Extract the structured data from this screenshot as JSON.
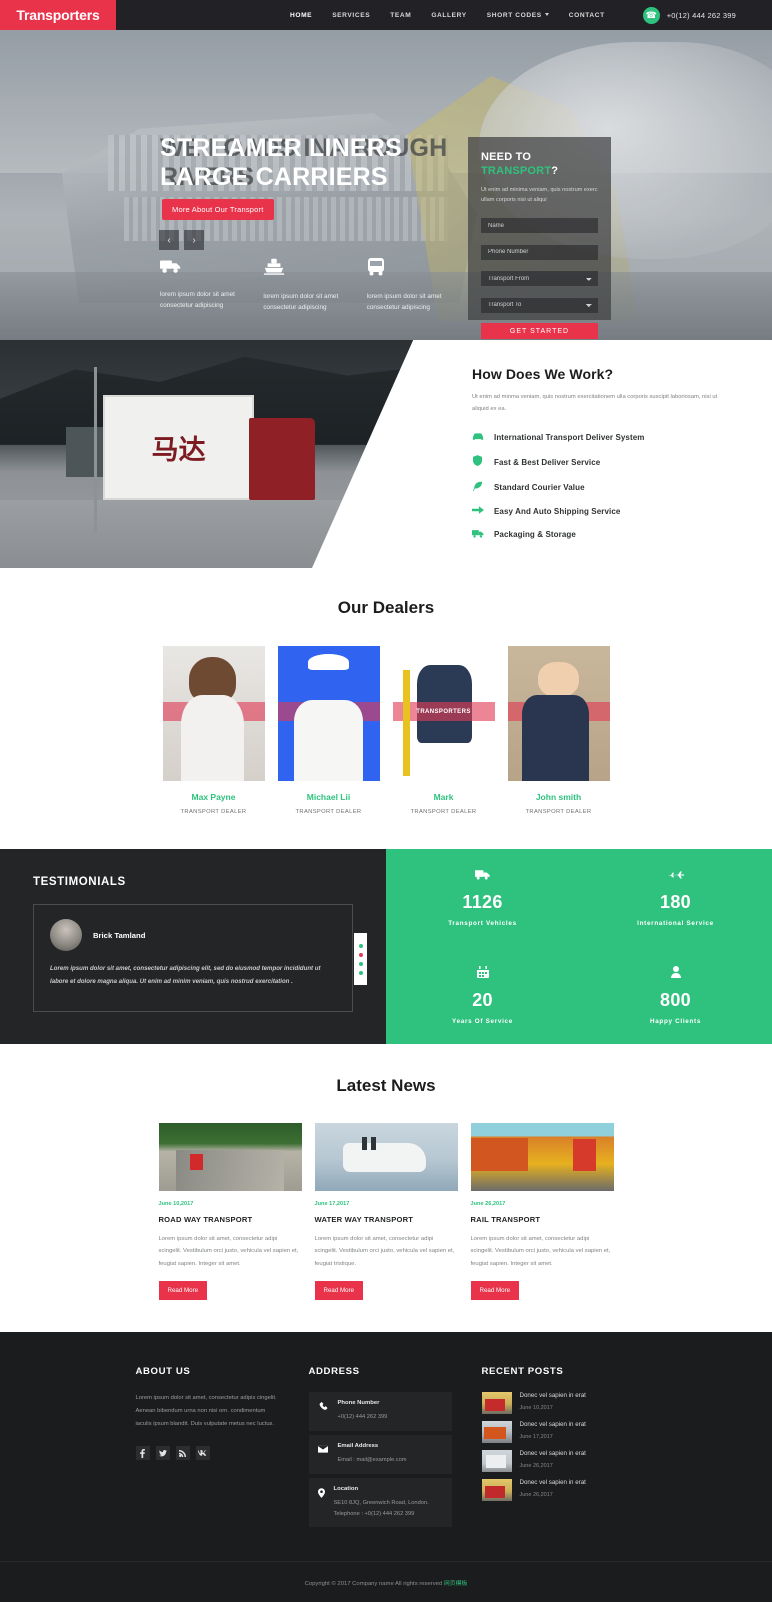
{
  "header": {
    "brand": "Transporters",
    "nav": [
      {
        "label": "HOME",
        "active": true
      },
      {
        "label": "SERVICES",
        "active": false
      },
      {
        "label": "TEAM",
        "active": false
      },
      {
        "label": "GALLERY",
        "active": false
      },
      {
        "label": "SHORT CODES",
        "active": false,
        "caret": true
      },
      {
        "label": "CONTACT",
        "active": false
      }
    ],
    "phone": "+0(12) 444 262 399",
    "phone_icon": "phone-icon"
  },
  "hero": {
    "title_line1": "STREAMER LINERS",
    "title_line2": "LARGE CARRIERS",
    "ghost_line1": "WE LOADS IN",
    "ghost_line2": "A ROUGH RIVERS",
    "button": "More About Our Transport",
    "prev_icon": "chevron-left-icon",
    "next_icon": "chevron-right-icon",
    "features": [
      {
        "icon": "truck-icon",
        "glyph": "🚚",
        "text": "lorem ipsum dolor sit amet consectetur adipiscing"
      },
      {
        "icon": "ship-icon",
        "glyph": "⚓",
        "text": "lorem ipsum dolor sit amet consectetur adipiscing"
      },
      {
        "icon": "bus-icon",
        "glyph": "🚌",
        "text": "lorem ipsum dolor sit amet consectetur adipiscing"
      }
    ],
    "form": {
      "title_a": "NEED TO",
      "title_b": "TRANSPORT",
      "title_c": "?",
      "desc": "Ut enim ad minima veniam, quis nostrum exerc ullam corporis nisi ut aliqui",
      "name_placeholder": "Name",
      "phone_placeholder": "Phone Number",
      "from_selected": "Transport From",
      "to_selected": "Transport To",
      "submit": "GET STARTED"
    }
  },
  "how": {
    "title": "How Does We Work?",
    "desc": "Ut enim ad minma veniam, quis nostrum exercitationem ulla corporis suscipit laboriosam, nisi ut aliquid ex ea.",
    "items": [
      {
        "icon": "car-icon",
        "glyph": "🚗",
        "label": "International Transport Deliver System"
      },
      {
        "icon": "shield-icon",
        "glyph": "🛡",
        "label": "Fast & Best Deliver Service"
      },
      {
        "icon": "feather-icon",
        "glyph": "✒",
        "label": "Standard Courier Value"
      },
      {
        "icon": "arrow-icon",
        "glyph": "➤",
        "label": "Easy And Auto Shipping Service"
      },
      {
        "icon": "truck-icon",
        "glyph": "🚚",
        "label": "Packaging & Storage"
      }
    ],
    "image_chars": "马达"
  },
  "dealers": {
    "title": "Our Dealers",
    "overlay_label": "TRANSPORTERS",
    "items": [
      {
        "name": "Max Payne",
        "role": "TRANSPORT DEALER"
      },
      {
        "name": "Michael Lii",
        "role": "TRANSPORT DEALER"
      },
      {
        "name": "Mark",
        "role": "TRANSPORT DEALER"
      },
      {
        "name": "John smith",
        "role": "TRANSPORT DEALER"
      }
    ]
  },
  "testimonials": {
    "heading": "TESTIMONIALS",
    "author": "Brick Tamland",
    "quote": "Lorem ipsum dolor sit amet, consectetur adipiscing elit, sed do eiusmod tempor incididunt ut labore et dolore magna aliqua. Ut enim ad minim veniam, quis nostrud exercitation .",
    "dots": [
      {
        "active": false
      },
      {
        "active": true
      },
      {
        "active": false
      },
      {
        "active": false
      }
    ]
  },
  "stats": [
    {
      "icon": "truck-icon",
      "glyph": "🚚",
      "number": "1126",
      "label": "Transport Vehicles"
    },
    {
      "icon": "plane-icon",
      "glyph": "✈",
      "number": "180",
      "label": "International Service"
    },
    {
      "icon": "calendar-icon",
      "glyph": "📅",
      "number": "20",
      "label": "Years Of Service"
    },
    {
      "icon": "user-icon",
      "glyph": "👤",
      "number": "800",
      "label": "Happy Clients"
    }
  ],
  "news": {
    "title": "Latest News",
    "items": [
      {
        "date": "June 10,2017",
        "title": "ROAD WAY TRANSPORT",
        "text": "Lorem ipsum dolor sit amet, consectetur adipi scingelit. Vestibulum orci justo, vehicula vel sapien et, feugiat sapien. Integer sit amet.",
        "button": "Read More"
      },
      {
        "date": "June 17,2017",
        "title": "WATER WAY TRANSPORT",
        "text": "Lorem ipsum dolor sit amet, consectetur adipi scingelit. Vestibulum orci justo, vehicula vel sapien et, feugiat tristique.",
        "button": "Read More"
      },
      {
        "date": "June 26,2017",
        "title": "RAIL TRANSPORT",
        "text": "Lorem ipsum dolor sit amet, consectetur adipi scingelit. Vestibulum orci justo, vehicula vel sapien et, feugiat sapien. Integer sit amet.",
        "button": "Read More"
      }
    ]
  },
  "footer": {
    "about": {
      "heading": "ABOUT US",
      "text": "Lorem ipsum dolor sit amet, consectetur adipis cingelit. Aenean bibendum urna non nisi orn. condimentum iaculis ipsum blandit. Duis vulputate metus nec luctus.",
      "socials": [
        {
          "icon": "facebook-icon",
          "glyph": "f"
        },
        {
          "icon": "twitter-icon",
          "glyph": "𝕥"
        },
        {
          "icon": "rss-icon",
          "glyph": "☈"
        },
        {
          "icon": "vk-icon",
          "glyph": "в"
        }
      ]
    },
    "address": {
      "heading": "ADDRESS",
      "items": [
        {
          "icon": "phone-icon",
          "glyph": "✆",
          "title": "Phone Number",
          "value": "+0(12) 444 262 399"
        },
        {
          "icon": "envelope-icon",
          "glyph": "✉",
          "title": "Email Address",
          "value": "Email :  mail@example.com"
        },
        {
          "icon": "map-pin-icon",
          "glyph": "📍",
          "title": "Location",
          "value": "SE10 8JQ, Greenwich Road, London. Telephone :  +0(12) 444 262 399"
        }
      ]
    },
    "posts": {
      "heading": "RECENT POSTS",
      "items": [
        {
          "title": "Donec vel sapien in erat",
          "date": "June 10,2017"
        },
        {
          "title": "Donec vel sapien in erat",
          "date": "June 17,2017"
        },
        {
          "title": "Donec vel sapien in erat",
          "date": "June 26,2017"
        },
        {
          "title": "Donec vel sapien in erat",
          "date": "June 26,2017"
        }
      ]
    },
    "copyright": "Copyright © 2017 Company name All rights reserved ",
    "copyright_cn": "网页模板"
  },
  "colors": {
    "brand_red": "#e8334a",
    "accent_green": "#2ec27e",
    "dark": "#222226",
    "footer_dark": "#1b1c1e"
  }
}
